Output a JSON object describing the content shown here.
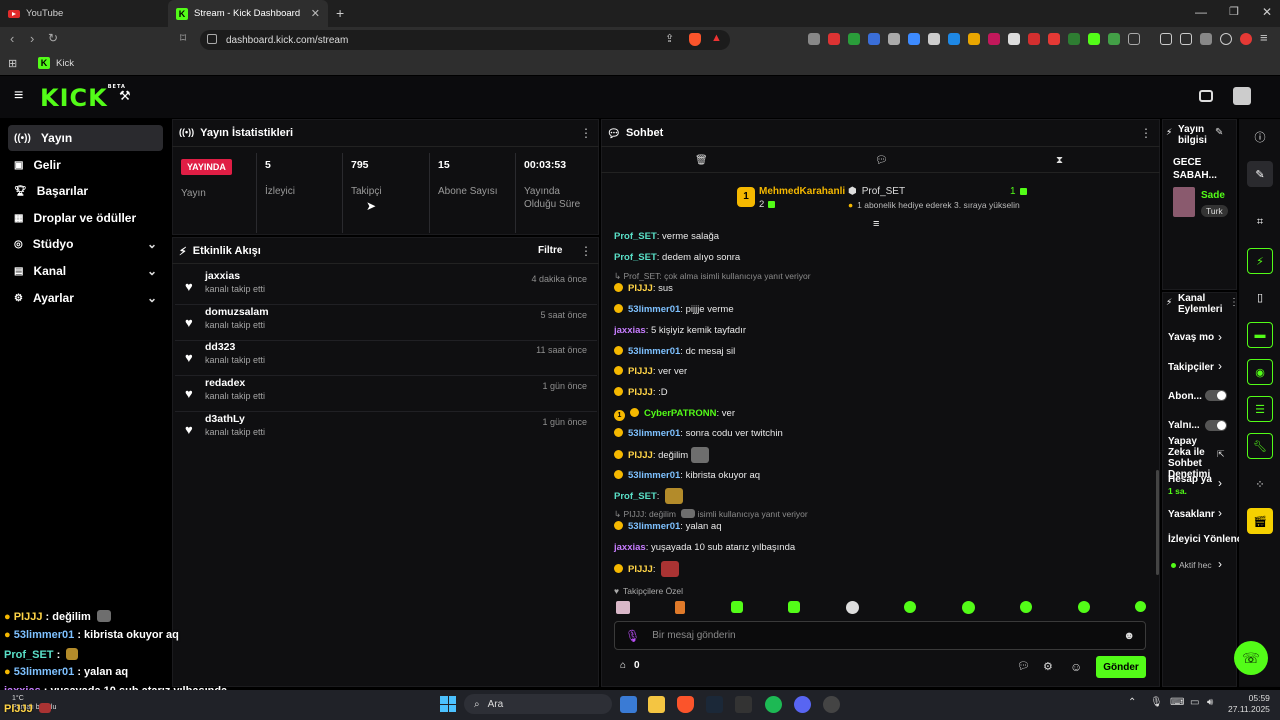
{
  "browser": {
    "tabs": [
      {
        "label": "YouTube"
      },
      {
        "label": "Stream - Kick Dashboard"
      }
    ],
    "url": "dashboard.kick.com/stream",
    "bookmark": "Kick"
  },
  "kick": {
    "logo": "KICK",
    "logo_beta": "BETA"
  },
  "sidebar": {
    "items": [
      {
        "label": "Yayın",
        "icon": "broadcast-icon"
      },
      {
        "label": "Gelir",
        "icon": "revenue-icon"
      },
      {
        "label": "Başarılar",
        "icon": "trophy-icon"
      },
      {
        "label": "Droplar ve ödüller",
        "icon": "gift-icon"
      },
      {
        "label": "Stüdyo",
        "icon": "studio-icon"
      },
      {
        "label": "Kanal",
        "icon": "channel-icon"
      },
      {
        "label": "Ayarlar",
        "icon": "gear-icon"
      }
    ]
  },
  "stats": {
    "title": "Yayın İstatistikleri",
    "live_badge": "YAYINDA",
    "live_label": "Yayın",
    "viewers": {
      "value": "5",
      "label": "İzleyici"
    },
    "followers": {
      "value": "795",
      "label": "Takipçi"
    },
    "subs": {
      "value": "15",
      "label": "Abone Sayısı"
    },
    "uptime": {
      "value": "00:03:53",
      "label1": "Yayında",
      "label2": "Olduğu Süre"
    }
  },
  "activity": {
    "title": "Etkinlik Akışı",
    "filter": "Filtre",
    "items": [
      {
        "name": "jaxxias",
        "sub": "kanalı takip etti",
        "time": "4 dakika önce"
      },
      {
        "name": "domuzsalam",
        "sub": "kanalı takip etti",
        "time": "5 saat önce"
      },
      {
        "name": "dd323",
        "sub": "kanalı takip etti",
        "time": "11 saat önce"
      },
      {
        "name": "redadex",
        "sub": "kanalı takip etti",
        "time": "1 gün önce"
      },
      {
        "name": "d3athLy",
        "sub": "kanalı takip etti",
        "time": "1 gün önce"
      }
    ]
  },
  "chat": {
    "title": "Sohbet",
    "pinned_left_name": "MehmedKarahanli",
    "pinned_left_count": "2",
    "pinned_left_rank": "1",
    "pinned_right_name": "Prof_SET",
    "pinned_right_count": "1",
    "pinned_right_text": "1 abonelik hediye ederek 3. sıraya yükselin",
    "messages": [
      {
        "user": "Prof_SET",
        "text": "verme salağa"
      },
      {
        "user": "Prof_SET",
        "text": "dedem alıyo sonra"
      },
      {
        "reply": "Prof_SET: çok alma isimli kullanıcıya yanıt veriyor"
      },
      {
        "user": "PIJJJ",
        "text": "sus"
      },
      {
        "user": "53limmer01",
        "text": "pijjje verme"
      },
      {
        "user": "jaxxias",
        "text": "5 kişiyiz kemik tayfadır"
      },
      {
        "user": "53limmer01",
        "text": "dc mesaj sil"
      },
      {
        "user": "PIJJJ",
        "text": "ver ver"
      },
      {
        "user": "PIJJJ",
        "text": ":D"
      },
      {
        "user": "CyberPATRONN",
        "text": "ver",
        "rank": "1"
      },
      {
        "user": "53limmer01",
        "text": "sonra codu ver twitchin"
      },
      {
        "user": "PIJJJ",
        "text": "değilim"
      },
      {
        "user": "53limmer01",
        "text": "kibrista okuyor aq"
      },
      {
        "user": "Prof_SET",
        "text": ""
      },
      {
        "reply_a": "PIJJJ: değilim",
        "reply_b": "isimli kullanıcıya yanıt veriyor"
      },
      {
        "user": "53limmer01",
        "text": "yalan aq"
      },
      {
        "user": "jaxxias",
        "text": "yuşayada 10 sub atarız yılbaşında"
      },
      {
        "user": "PIJJJ",
        "text": ""
      }
    ],
    "followers_only": "Takipçilere Özel",
    "input_placeholder": "Bir mesaj gönderin",
    "points": "0",
    "send": "Gönder"
  },
  "stream_info": {
    "title": "Yayın bilgisi",
    "stream_title": "GECE SABAH...",
    "user": "Sade",
    "tag": "Turk"
  },
  "channel_actions": {
    "title": "Kanal Eylemleri",
    "items": [
      "Yavaş mo",
      "Takipçiler",
      "Abon...",
      "Yalnı...",
      "Yapay Zeka ile Sohbet Denetimi",
      "Hesap ya",
      "Yasaklanr",
      "İzleyici Yönlenc"
    ],
    "ai_sub": "1 sa.",
    "viewer_sub": "Aktif hec"
  },
  "overlay": [
    {
      "user": "PIJJJ",
      "text": ": değilim"
    },
    {
      "user": "53limmer01",
      "text": ": kibrista okuyor aq"
    },
    {
      "user": "Prof_SET",
      "text": ":"
    },
    {
      "user": "53limmer01",
      "text": ": yalan aq"
    },
    {
      "user": "jaxxias",
      "text": ": yuşayada 10 sub atarız yılbaşında"
    },
    {
      "user": "PIJJJ",
      "text": ""
    }
  ],
  "weather": {
    "temp": "1°C",
    "desc": "Parçalı bulutlu"
  },
  "taskbar": {
    "search": "Ara",
    "time": "05:59",
    "date": "27.11.2025"
  }
}
